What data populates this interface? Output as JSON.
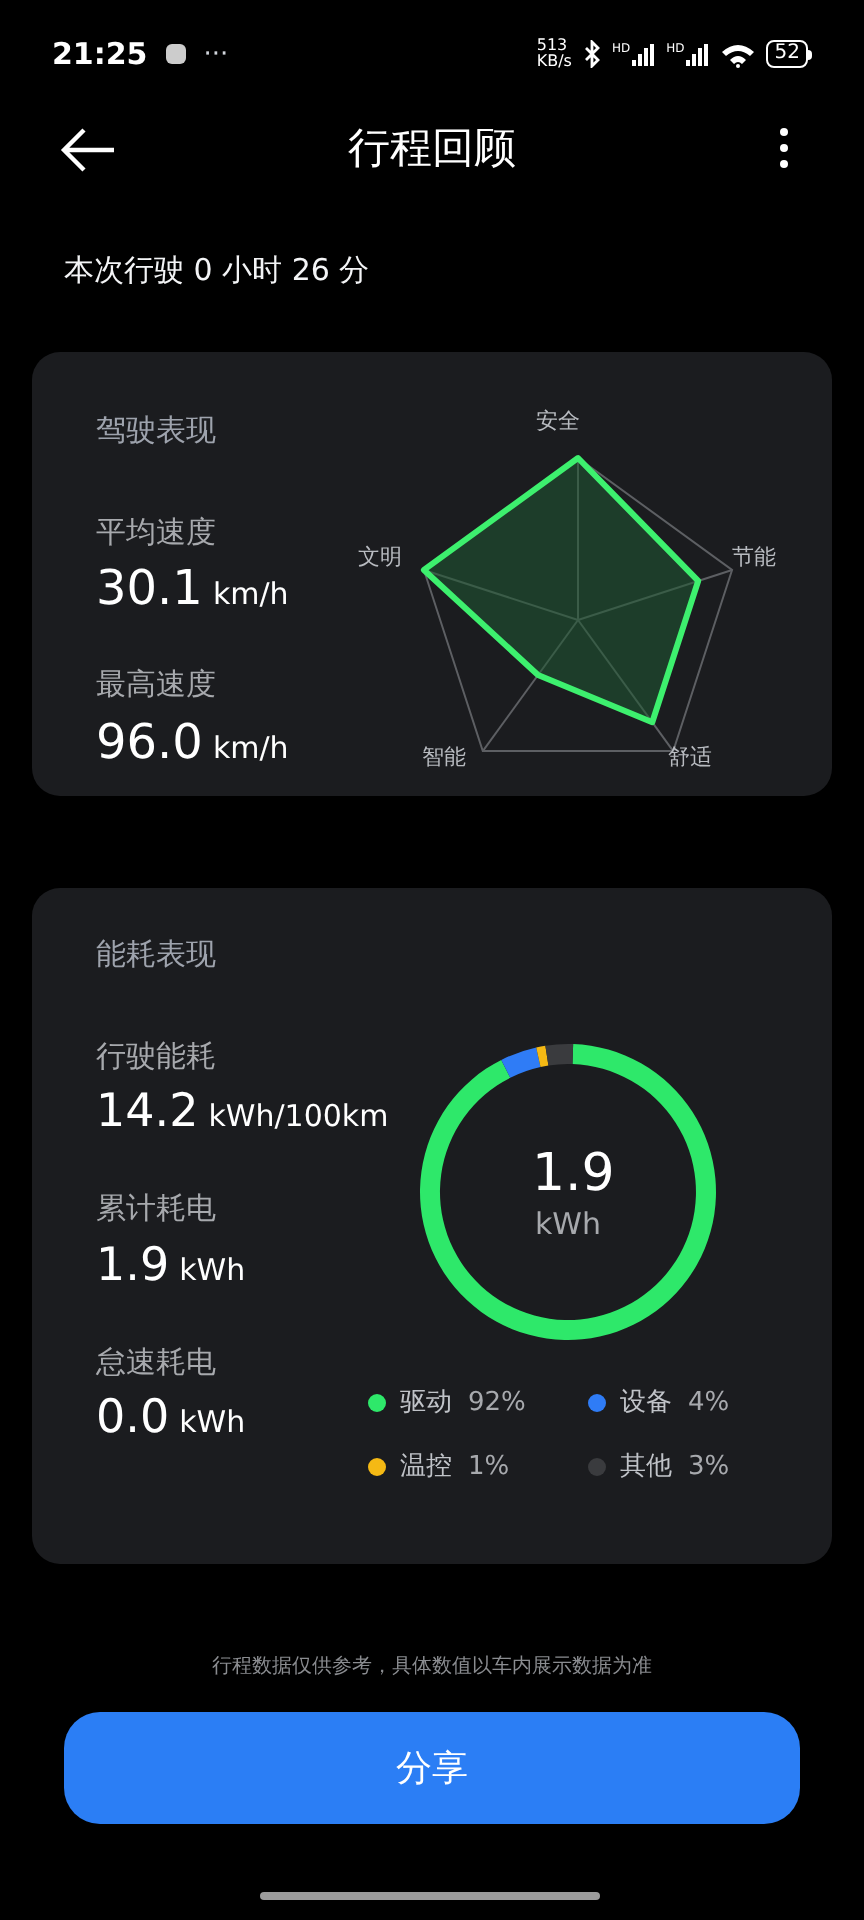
{
  "status_bar": {
    "time": "21:25",
    "more": "···",
    "speed_value": "513",
    "speed_unit": "KB/s",
    "signal_labels": [
      "HD",
      "HD"
    ],
    "battery": "52"
  },
  "header": {
    "title": "行程回顾"
  },
  "trip": {
    "duration": "本次行驶 0 小时 26 分"
  },
  "driving_card": {
    "title": "驾驶表现",
    "stats": [
      {
        "label": "平均速度",
        "value": "30.1",
        "unit": "km/h"
      },
      {
        "label": "最高速度",
        "value": "96.0",
        "unit": "km/h"
      }
    ],
    "radar_labels": [
      "安全",
      "节能",
      "舒适",
      "智能",
      "文明"
    ]
  },
  "energy_card": {
    "title": "能耗表现",
    "stats": [
      {
        "label": "行驶能耗",
        "value": "14.2",
        "unit": "kWh/100km"
      },
      {
        "label": "累计耗电",
        "value": "1.9",
        "unit": "kWh"
      },
      {
        "label": "怠速耗电",
        "value": "0.0",
        "unit": "kWh"
      }
    ],
    "center_value": "1.9",
    "center_unit": "kWh",
    "chart_data": {
      "type": "donut",
      "categories": [
        "驱动",
        "设备",
        "温控",
        "其他"
      ],
      "series": [
        {
          "values": [
            92,
            4,
            1,
            3
          ]
        }
      ]
    },
    "legend": [
      {
        "percent": "92%",
        "color": "#2ee86a"
      },
      {
        "percent": "4%",
        "color": "#2f7cf6"
      },
      {
        "percent": "1%",
        "color": "#f5b914"
      },
      {
        "percent": "3%",
        "color": "#3a3b3e"
      }
    ]
  },
  "footer": {
    "disclaimer": "行程数据仅供参考，具体数值以车内展示数据为准",
    "share_button": "分享"
  }
}
